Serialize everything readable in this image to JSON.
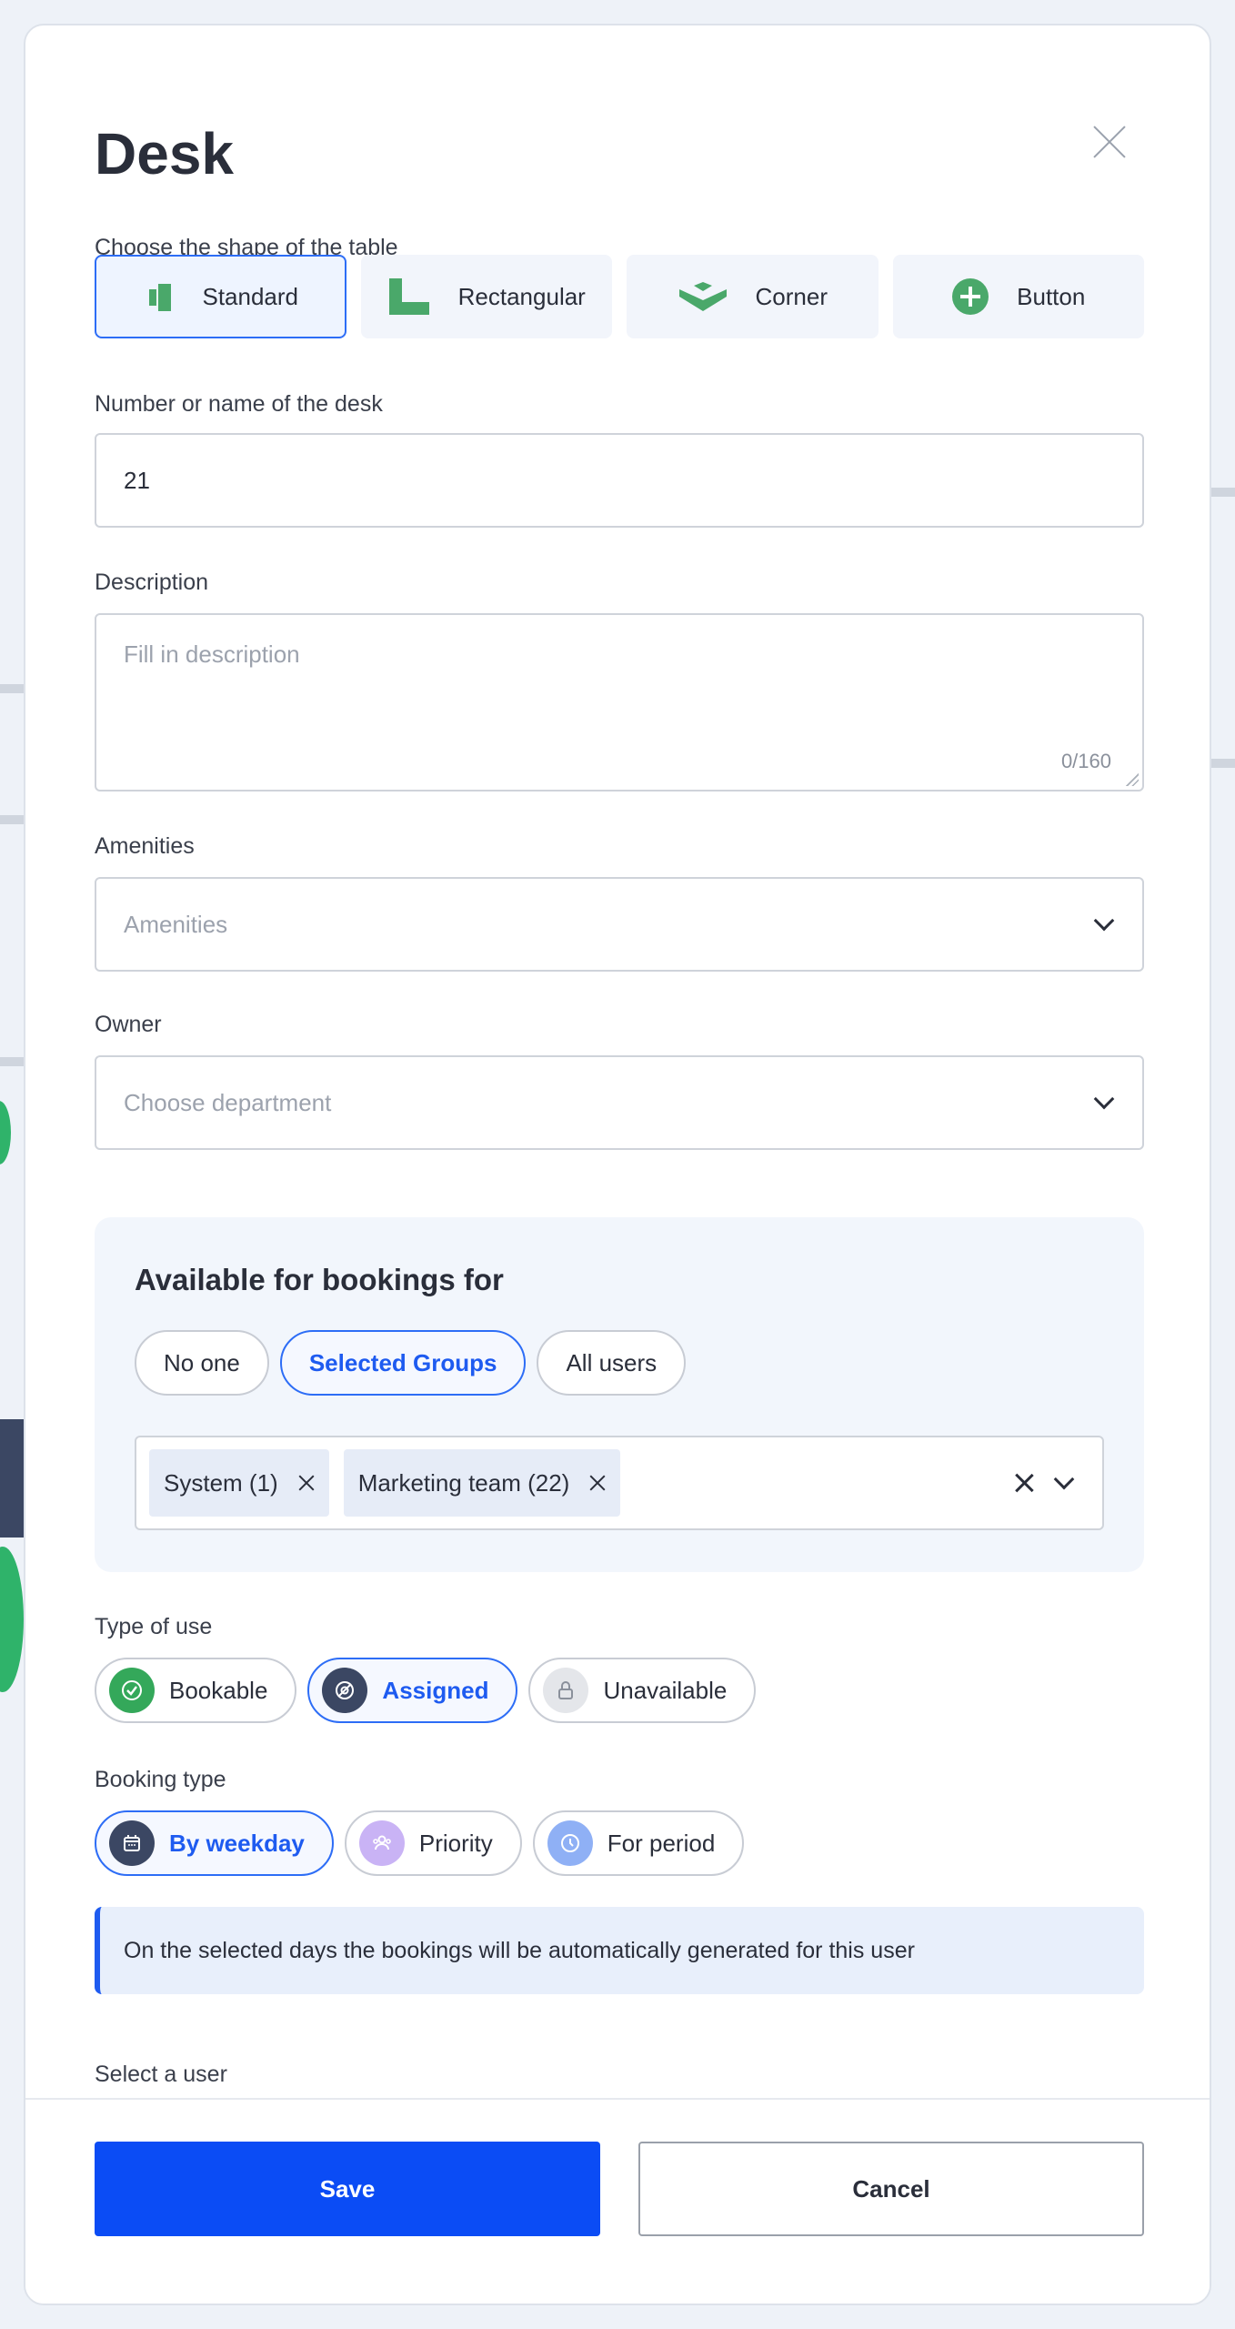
{
  "modal": {
    "title": "Desk"
  },
  "shape": {
    "label": "Choose the shape of the table",
    "options": [
      {
        "label": "Standard",
        "icon": "standard-desk-icon"
      },
      {
        "label": "Rectangular",
        "icon": "rectangular-desk-icon"
      },
      {
        "label": "Corner",
        "icon": "corner-desk-icon"
      },
      {
        "label": "Button",
        "icon": "plus-circle-icon"
      }
    ],
    "selected": "Standard"
  },
  "desk_name": {
    "label": "Number or name of the desk",
    "value": "21"
  },
  "description": {
    "label": "Description",
    "placeholder": "Fill in description",
    "counter": "0/160"
  },
  "amenities": {
    "label": "Amenities",
    "placeholder": "Amenities"
  },
  "owner": {
    "label": "Owner",
    "placeholder": "Choose department"
  },
  "availability": {
    "title": "Available for bookings for",
    "options": [
      "No one",
      "Selected Groups",
      "All users"
    ],
    "selected": "Selected Groups",
    "groups": [
      "System (1)",
      "Marketing team (22)"
    ]
  },
  "type_of_use": {
    "label": "Type of use",
    "options": [
      {
        "label": "Bookable",
        "icon": "check-circle-icon",
        "color": "#34a85a"
      },
      {
        "label": "Assigned",
        "icon": "assigned-icon",
        "color": "#3b4763"
      },
      {
        "label": "Unavailable",
        "icon": "lock-icon",
        "color": "#e4e6ea"
      }
    ],
    "selected": "Assigned"
  },
  "booking_type": {
    "label": "Booking type",
    "options": [
      {
        "label": "By weekday",
        "icon": "calendar-icon",
        "color": "#3b4763"
      },
      {
        "label": "Priority",
        "icon": "people-icon",
        "color": "#c9b3f5"
      },
      {
        "label": "For period",
        "icon": "clock-icon",
        "color": "#8fb0f5"
      }
    ],
    "selected": "By weekday"
  },
  "info_text": "On the selected days the bookings will be automatically generated for this user",
  "select_user": {
    "label": "Select a user"
  },
  "footer": {
    "save_label": "Save",
    "cancel_label": "Cancel"
  },
  "colors": {
    "accent": "#0b4cf5",
    "brand_green": "#34a85a"
  }
}
